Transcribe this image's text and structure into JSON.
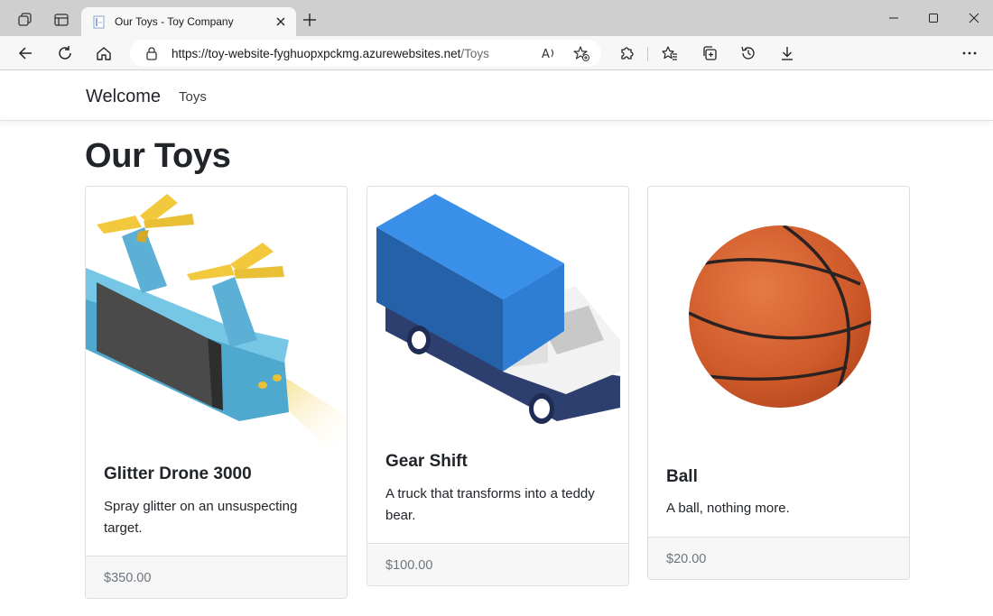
{
  "browser": {
    "tab": {
      "title": "Our Toys - Toy Company"
    },
    "address": {
      "url_host": "https://toy-website-fyghuopxpckmg.azurewebsites.net",
      "url_path": "/Toys"
    }
  },
  "nav": {
    "brand": "Welcome",
    "links": [
      "Toys"
    ]
  },
  "page": {
    "title": "Our Toys"
  },
  "products": [
    {
      "name": "Glitter Drone 3000",
      "description": "Spray glitter on an unsuspecting target.",
      "price": "$350.00",
      "image": "drone-illustration"
    },
    {
      "name": "Gear Shift",
      "description": "A truck that transforms into a teddy bear.",
      "price": "$100.00",
      "image": "truck-illustration"
    },
    {
      "name": "Ball",
      "description": "A ball, nothing more.",
      "price": "$20.00",
      "image": "basketball-illustration"
    }
  ]
}
